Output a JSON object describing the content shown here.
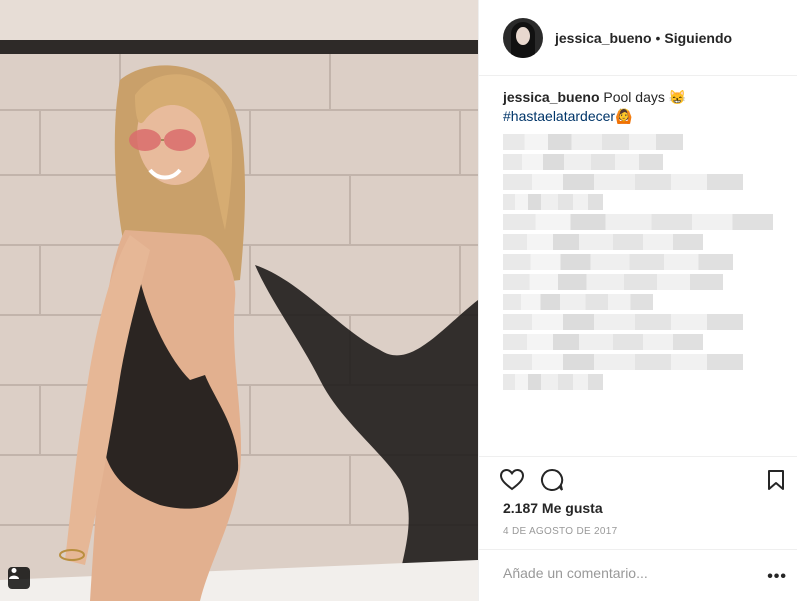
{
  "post": {
    "username": "jessica_bueno",
    "separator": "•",
    "follow_status": "Siguiendo",
    "caption": {
      "username": "jessica_bueno",
      "text": "Pool days 😸",
      "hashtag": "#hastaelatardecer🙆"
    },
    "likes_text": "2.187 Me gusta",
    "date_text": "4 DE AGOSTO DE 2017",
    "comment_placeholder": "Añade un comentario...",
    "more_label": "•••"
  },
  "icons": {
    "like": "heart-icon",
    "comment": "comment-icon",
    "save": "bookmark-icon",
    "tagged": "user-tag-icon"
  },
  "colors": {
    "text": "#262626",
    "secondary": "#999999",
    "hashtag": "#003569",
    "divider": "#efefef"
  }
}
